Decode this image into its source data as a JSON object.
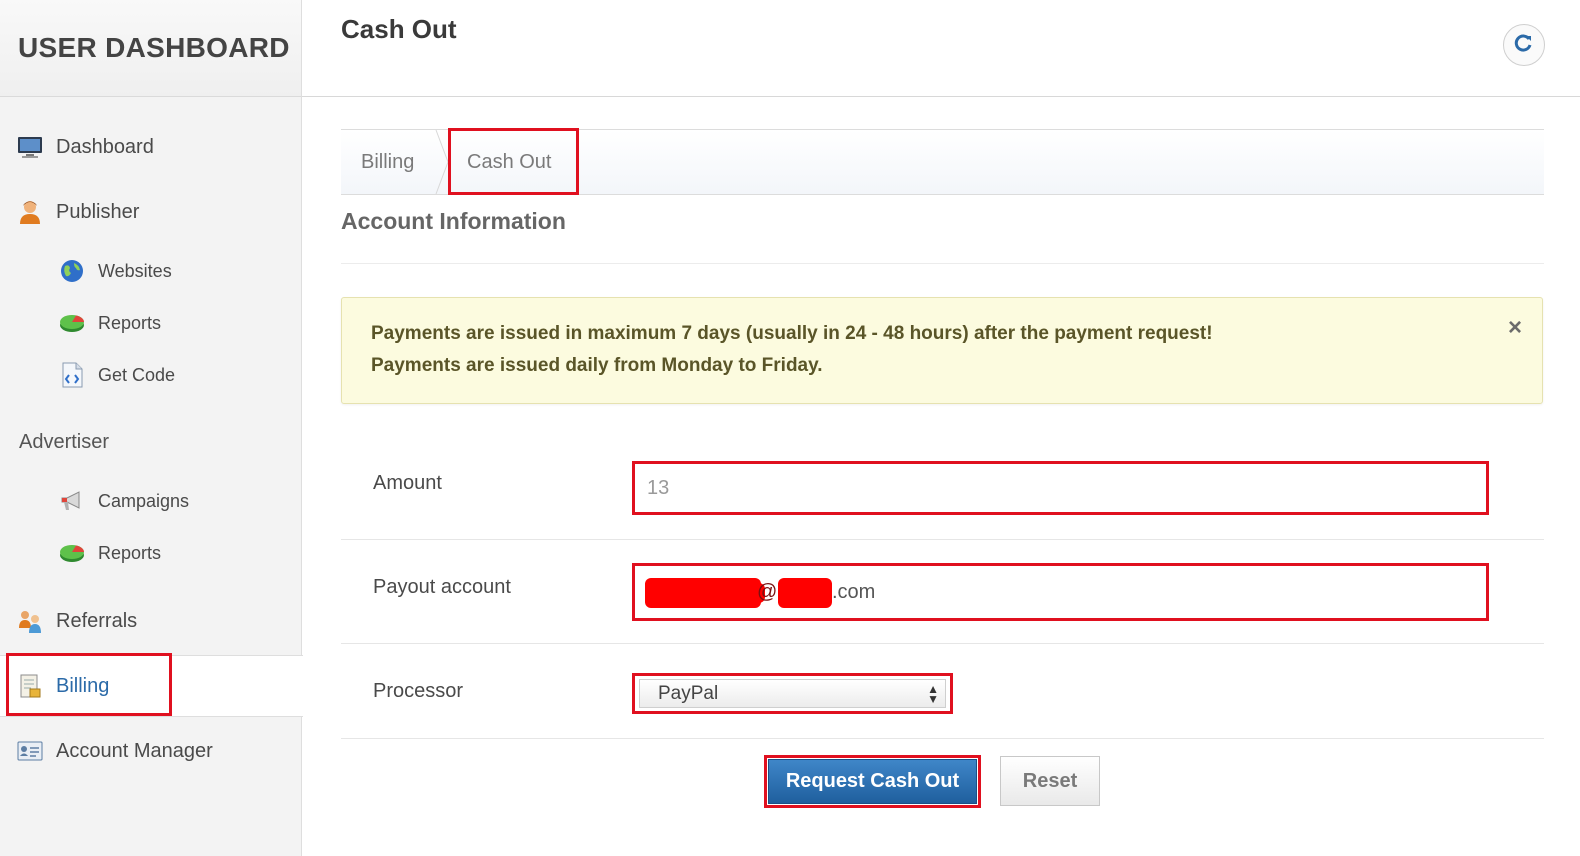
{
  "sidebar": {
    "brand": "USER DASHBOARD",
    "dashboard": {
      "label": "Dashboard",
      "icon": "monitor-icon"
    },
    "publisher": {
      "label": "Publisher",
      "icon": "user-icon"
    },
    "websites": {
      "label": "Websites",
      "icon": "globe-icon"
    },
    "publisher_reports": {
      "label": "Reports",
      "icon": "pie-chart-icon"
    },
    "get_code": {
      "label": "Get Code",
      "icon": "code-file-icon"
    },
    "advertiser_section": "Advertiser",
    "campaigns": {
      "label": "Campaigns",
      "icon": "megaphone-icon"
    },
    "advertiser_reports": {
      "label": "Reports",
      "icon": "pie-chart-icon"
    },
    "referrals": {
      "label": "Referrals",
      "icon": "users-icon"
    },
    "billing": {
      "label": "Billing",
      "icon": "ledger-icon",
      "active": true
    },
    "account_manager": {
      "label": "Account Manager",
      "icon": "id-card-icon"
    }
  },
  "header": {
    "title": "Cash Out",
    "refresh_icon": "refresh-icon"
  },
  "tabs": [
    {
      "label": "Billing",
      "active": false
    },
    {
      "label": "Cash Out",
      "active": true
    }
  ],
  "section_title": "Account Information",
  "alert": {
    "line1": "Payments are issued in maximum 7 days (usually in 24 - 48 hours) after the payment request!",
    "line2": "Payments are issued daily from Monday to Friday.",
    "close_glyph": "×"
  },
  "form": {
    "amount": {
      "label": "Amount",
      "placeholder": "13",
      "value": ""
    },
    "payout": {
      "label": "Payout account",
      "visible_value": "@ .com",
      "suffix": ".com"
    },
    "processor": {
      "label": "Processor",
      "selected": "PayPal"
    }
  },
  "buttons": {
    "submit": "Request Cash Out",
    "reset": "Reset"
  },
  "colors": {
    "highlight": "#e0101f",
    "primary": "#2a6fb0",
    "alert_bg": "#fcfbdf",
    "redaction": "#ff0000"
  }
}
